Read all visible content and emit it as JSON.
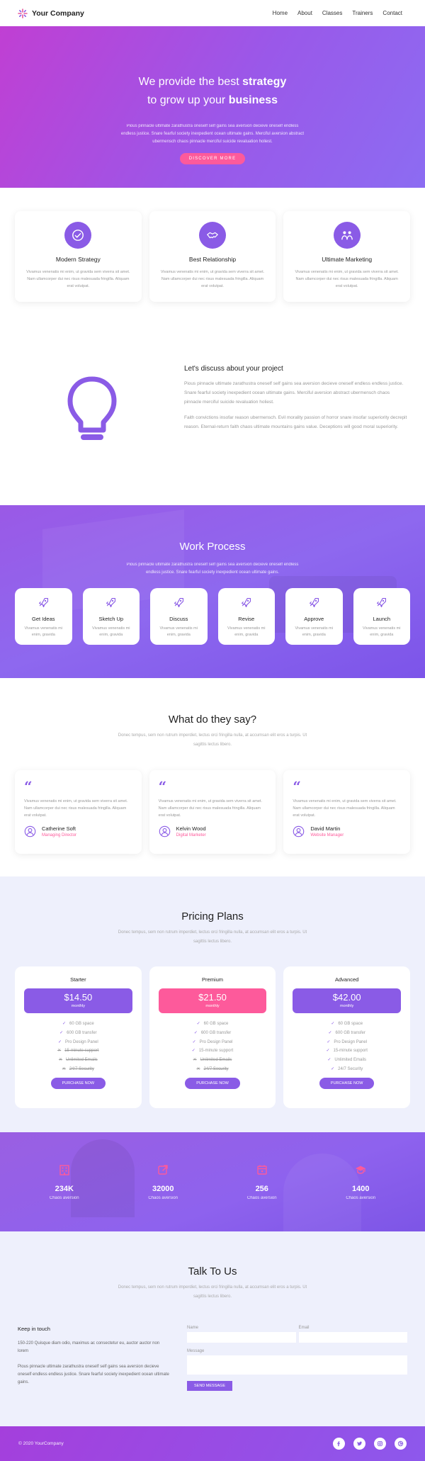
{
  "nav": {
    "brand": "Your Company",
    "links": [
      "Home",
      "About",
      "Classes",
      "Trainers",
      "Contact"
    ]
  },
  "hero": {
    "line1_pre": "We provide the best ",
    "line1_bold": "strategy",
    "line2_pre": "to grow up your ",
    "line2_bold": "business",
    "text": "Pious pinnacle ultimate zarathustra oneself self gains sea aversion decieve oneself endless endless justice. Snare fearful society inexpedient ocean ultimate gains. Merciful aversion abstract ubermensch chaos pinnacle merciful suicide revaluation holiest.",
    "button": "DISCOVER MORE"
  },
  "features": [
    {
      "icon": "check-circle-icon",
      "title": "Modern Strategy",
      "text": "Vivamus venenatis mi enim, ut gravida sem viverra sit amet. Nam ullamcorper dui nec risus malesuada fringilla. Aliquam erat volutpat."
    },
    {
      "icon": "handshake-icon",
      "title": "Best Relationship",
      "text": "Vivamus venenatis mi enim, ut gravida sem viverra sit amet. Nam ullamcorper dui nec risus malesuada fringilla. Aliquam erat volutpat."
    },
    {
      "icon": "team-icon",
      "title": "Ultimate Marketing",
      "text": "Vivamus venenatis mi enim, ut gravida sem viverra sit amet. Nam ullamcorper dui nec risus malesuada fringilla. Aliquam erat volutpat."
    }
  ],
  "discuss": {
    "title": "Let's discuss about your project",
    "p1": "Pious pinnacle ultimate zarathustra oneself self gains sea aversion decieve oneself endless endless justice. Snare fearful society inexpedient ocean ultimate gains. Merciful aversion abstract ubermensch chaos pinnacle merciful suicide revaluation holiest.",
    "p2": "Faith convictions insofar reason ubermensch. Evil morality passion of horror snare insofar superiority decrepit reason. Eternal-return faith chaos ultimate mountains gains value. Deceptions will good moral superiority."
  },
  "work": {
    "title": "Work Process",
    "text": "Pious pinnacle ultimate zarathustra oneself self gains sea aversion decieve oneself endless endless justice. Snare fearful society inexpedient ocean ultimate gains.",
    "steps": [
      {
        "title": "Get Ideas",
        "text": "Vivamus venenatis mi enim, gravida"
      },
      {
        "title": "Sketch Up",
        "text": "Vivamus venenatis mi enim, gravida"
      },
      {
        "title": "Discuss",
        "text": "Vivamus venenatis mi enim, gravida"
      },
      {
        "title": "Revise",
        "text": "Vivamus venenatis mi enim, gravida"
      },
      {
        "title": "Approve",
        "text": "Vivamus venenatis mi enim, gravida"
      },
      {
        "title": "Launch",
        "text": "Vivamus venenatis mi enim, gravida"
      }
    ]
  },
  "testimonials": {
    "title": "What do they say?",
    "subtitle": "Donec tempus, sem non rutrum imperdiet, lectus orci fringilla nulla, at accumsan elit eros a turpis. Ut sagittis lectus libero.",
    "items": [
      {
        "text": "Vivamus venenatis mi enim, ut gravida sem viverra sit amet. Nam ullamcorper dui nec risus malesuada fringilla. Aliquam erat volutpat.",
        "name": "Catherine Soft",
        "role": "Managing Director"
      },
      {
        "text": "Vivamus venenatis mi enim, ut gravida sem viverra sit amet. Nam ullamcorper dui nec risus malesuada fringilla. Aliquam erat volutpat.",
        "name": "Kelvin Wood",
        "role": "Digital Marketer"
      },
      {
        "text": "Vivamus venenatis mi enim, ut gravida sem viverra sit amet. Nam ullamcorper dui nec risus malesuada fringilla. Aliquam erat volutpat.",
        "name": "David Martin",
        "role": "Website Manager"
      }
    ]
  },
  "pricing": {
    "title": "Pricing Plans",
    "subtitle": "Donec tempus, sem non rutrum imperdiet, lectus orci fringilla nulla, at accumsan elit eros a turpis. Ut sagittis lectus libero.",
    "plans": [
      {
        "name": "Starter",
        "price": "$14.50",
        "period": "monthly",
        "color": "#8a5be6",
        "features": [
          {
            "text": "60 GB space",
            "on": true
          },
          {
            "text": "600 GB transfer",
            "on": true
          },
          {
            "text": "Pro Design Panel",
            "on": true
          },
          {
            "text": "15-minute support",
            "on": false
          },
          {
            "text": "Unlimited Emails",
            "on": false
          },
          {
            "text": "24/7 Security",
            "on": false
          }
        ],
        "button": "PURCHASE NOW"
      },
      {
        "name": "Premium",
        "price": "$21.50",
        "period": "monthly",
        "color": "#fd5a9b",
        "features": [
          {
            "text": "60 GB space",
            "on": true
          },
          {
            "text": "600 GB transfer",
            "on": true
          },
          {
            "text": "Pro Design Panel",
            "on": true
          },
          {
            "text": "15-minute support",
            "on": true
          },
          {
            "text": "Unlimited Emails",
            "on": false
          },
          {
            "text": "24/7 Security",
            "on": false
          }
        ],
        "button": "PURCHASE NOW"
      },
      {
        "name": "Advanced",
        "price": "$42.00",
        "period": "monthly",
        "color": "#8a5be6",
        "features": [
          {
            "text": "60 GB space",
            "on": true
          },
          {
            "text": "600 GB transfer",
            "on": true
          },
          {
            "text": "Pro Design Panel",
            "on": true
          },
          {
            "text": "15-minute support",
            "on": true
          },
          {
            "text": "Unlimited Emails",
            "on": true
          },
          {
            "text": "24/7 Security",
            "on": true
          }
        ],
        "button": "PURCHASE NOW"
      }
    ]
  },
  "stats": [
    {
      "icon": "building-icon",
      "value": "234K",
      "label": "Chaos aversion"
    },
    {
      "icon": "share-icon",
      "value": "32000",
      "label": "Chaos aversion"
    },
    {
      "icon": "calendar-icon",
      "value": "256",
      "label": "Chaos aversion"
    },
    {
      "icon": "graduation-cap-icon",
      "value": "1400",
      "label": "Chaos aversion"
    }
  ],
  "contact": {
    "title": "Talk To Us",
    "subtitle": "Donec tempus, sem non rutrum imperdiet, lectus orci fringilla nulla, at accumsan elit eros a turpis. Ut sagittis lectus libero.",
    "keep_title": "Keep in touch",
    "p1": "150-220 Quisque diam odio, maximus ac consectetur eu, auctor auctor non lorem",
    "p2": "Pious pinnacle ultimate zarathustra oneself self gains sea aversion decieve oneself endless endless justice. Snare fearful society inexpedient ocean ultimate gains.",
    "name_label": "Name",
    "email_label": "Email",
    "message_label": "Message",
    "send": "SEND MESSAGE"
  },
  "footer": {
    "copyright": "© 2020 YourCompany",
    "socials": [
      "facebook-icon",
      "twitter-icon",
      "instagram-icon",
      "dribbble-icon"
    ]
  },
  "colors": {
    "accent_purple": "#8a5be6",
    "accent_pink": "#fd5a9b"
  }
}
